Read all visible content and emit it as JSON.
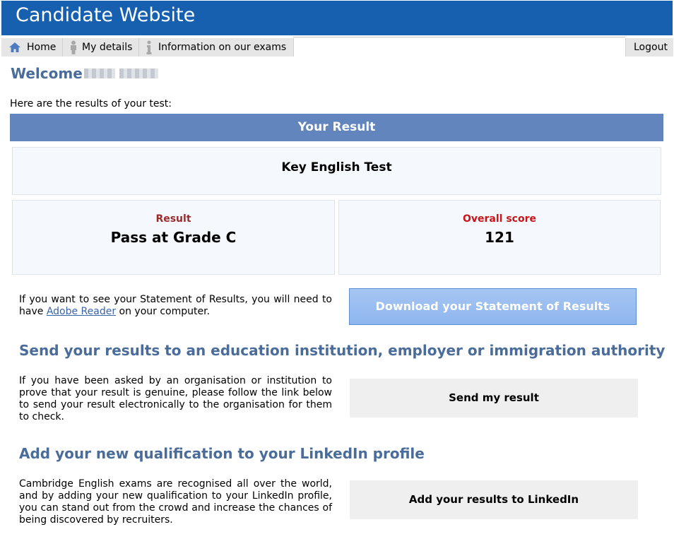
{
  "header": {
    "title": "Candidate Website",
    "color": "#1760b0"
  },
  "nav": {
    "tabs": [
      {
        "label": "Home",
        "icon": "home-icon"
      },
      {
        "label": "My details",
        "icon": "person-icon"
      },
      {
        "label": "Information on our exams",
        "icon": "info-icon"
      }
    ],
    "logout_label": "Logout"
  },
  "welcome": {
    "label": "Welcome"
  },
  "intro_text": "Here are the results of your test:",
  "result_section": {
    "heading": "Your Result",
    "test_name": "Key English Test",
    "result_label": "Result",
    "result_value": "Pass at Grade C",
    "score_label": "Overall score",
    "score_value": "121"
  },
  "statement": {
    "text_before": "If you want to see your Statement of Results, you will need to have ",
    "link_text": "Adobe Reader",
    "text_after": " on your computer.",
    "button_label": "Download your Statement of Results"
  },
  "send_section": {
    "heading": "Send your results to an education institution, employer or immigration authority",
    "text": "If you have been asked by an organisation or institution to prove that your result is genuine, please follow the link below to send your result electronically to the organisation for them to check.",
    "button_label": "Send my result"
  },
  "linkedin_section": {
    "heading": "Add your new qualification to your LinkedIn profile",
    "text": "Cambridge English exams are recognised all over the world, and by adding your new qualification to your LinkedIn profile, you can stand out from the crowd and increase the chances of being discovered by recruiters.",
    "button_label": "Add your results to LinkedIn"
  }
}
